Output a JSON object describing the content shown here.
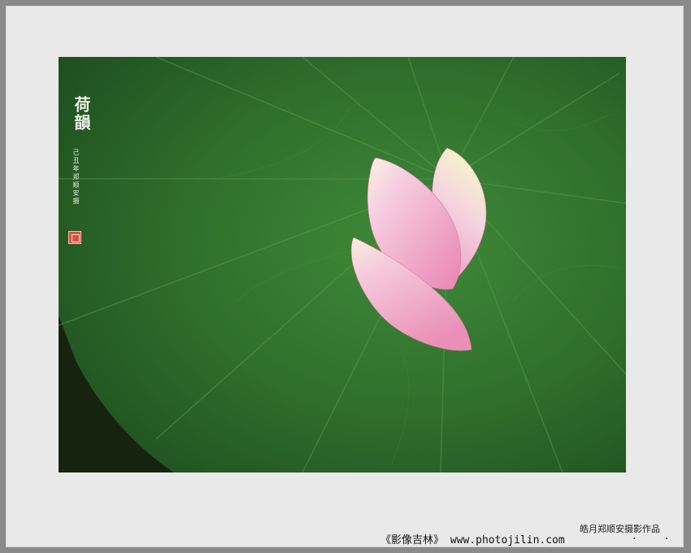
{
  "artwork": {
    "subject": "Lotus petals on a lotus leaf",
    "title_vertical": "荷韻",
    "signature_vertical": "己丑年郑顺安摄",
    "seal": "red-seal-stamp"
  },
  "footer": {
    "credit": "皓月郑顺安摄影作品",
    "site": "《影像吉林》 www.photojilin.com",
    "dots": ". ."
  },
  "colors": {
    "frame": "#8a8a8a",
    "mat": "#e9e9e9",
    "leaf": "#2f6e2c",
    "petal": "#f3a9c8"
  }
}
